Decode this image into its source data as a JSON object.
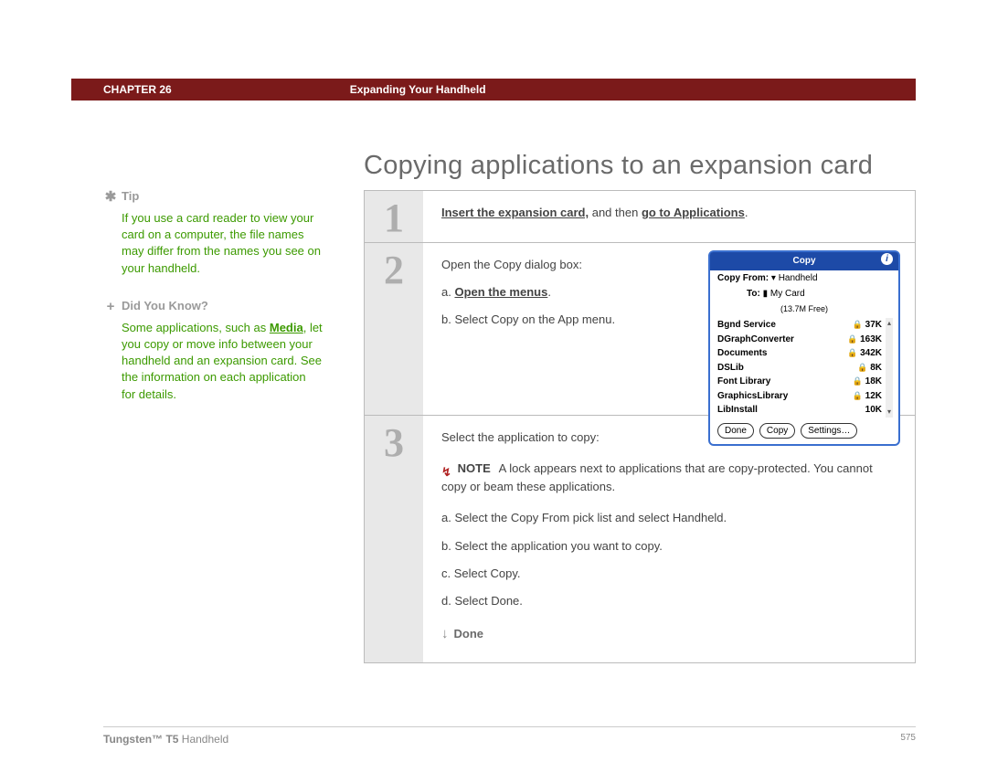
{
  "header": {
    "chapter": "CHAPTER 26",
    "section": "Expanding Your Handheld"
  },
  "title": "Copying applications to an expansion card",
  "sidebar": {
    "tip": {
      "label": "Tip",
      "body": "If you use a card reader to view your card on a computer, the file names may differ from the names you see on your handheld."
    },
    "didyouknow": {
      "label": "Did You Know?",
      "body_pre": "Some applications, such as ",
      "link": "Media",
      "body_post": ", let you copy or move info between your handheld and an expansion card. See the information on each application for details."
    }
  },
  "steps": {
    "s1": {
      "num": "1",
      "link1": "Insert the expansion card,",
      "mid": " and then ",
      "link2": "go to Applications",
      "end": "."
    },
    "s2": {
      "num": "2",
      "lead": "Open the Copy dialog box:",
      "a_pre": "a.  ",
      "a_link": "Open the menus",
      "a_post": ".",
      "b": "b.  Select Copy on the App menu."
    },
    "s3": {
      "num": "3",
      "lead": "Select the application to copy:",
      "note_label": "NOTE",
      "note_body": "A lock appears next to applications that are copy-protected. You cannot copy or beam these applications.",
      "a": "a.  Select the Copy From pick list and select Handheld.",
      "b": "b.  Select the application you want to copy.",
      "c": "c.  Select Copy.",
      "d": "d.  Select Done.",
      "done": "Done"
    }
  },
  "palm": {
    "title": "Copy",
    "from_label": "Copy From:",
    "from_value": " Handheld",
    "to_label": "To:",
    "to_value": " My Card",
    "free": "(13.7M Free)",
    "items": [
      {
        "name": "Bgnd Service",
        "lock": true,
        "size": "37K"
      },
      {
        "name": "DGraphConverter",
        "lock": true,
        "size": "163K"
      },
      {
        "name": "Documents",
        "lock": true,
        "size": "342K"
      },
      {
        "name": "DSLib",
        "lock": true,
        "size": "8K"
      },
      {
        "name": "Font Library",
        "lock": true,
        "size": "18K"
      },
      {
        "name": "GraphicsLibrary",
        "lock": true,
        "size": "12K"
      },
      {
        "name": "LibInstall",
        "lock": false,
        "size": "10K"
      }
    ],
    "btn_done": "Done",
    "btn_copy": "Copy",
    "btn_settings": "Settings…"
  },
  "footer": {
    "product_bold": "Tungsten™ T5",
    "product_rest": " Handheld",
    "page": "575"
  }
}
